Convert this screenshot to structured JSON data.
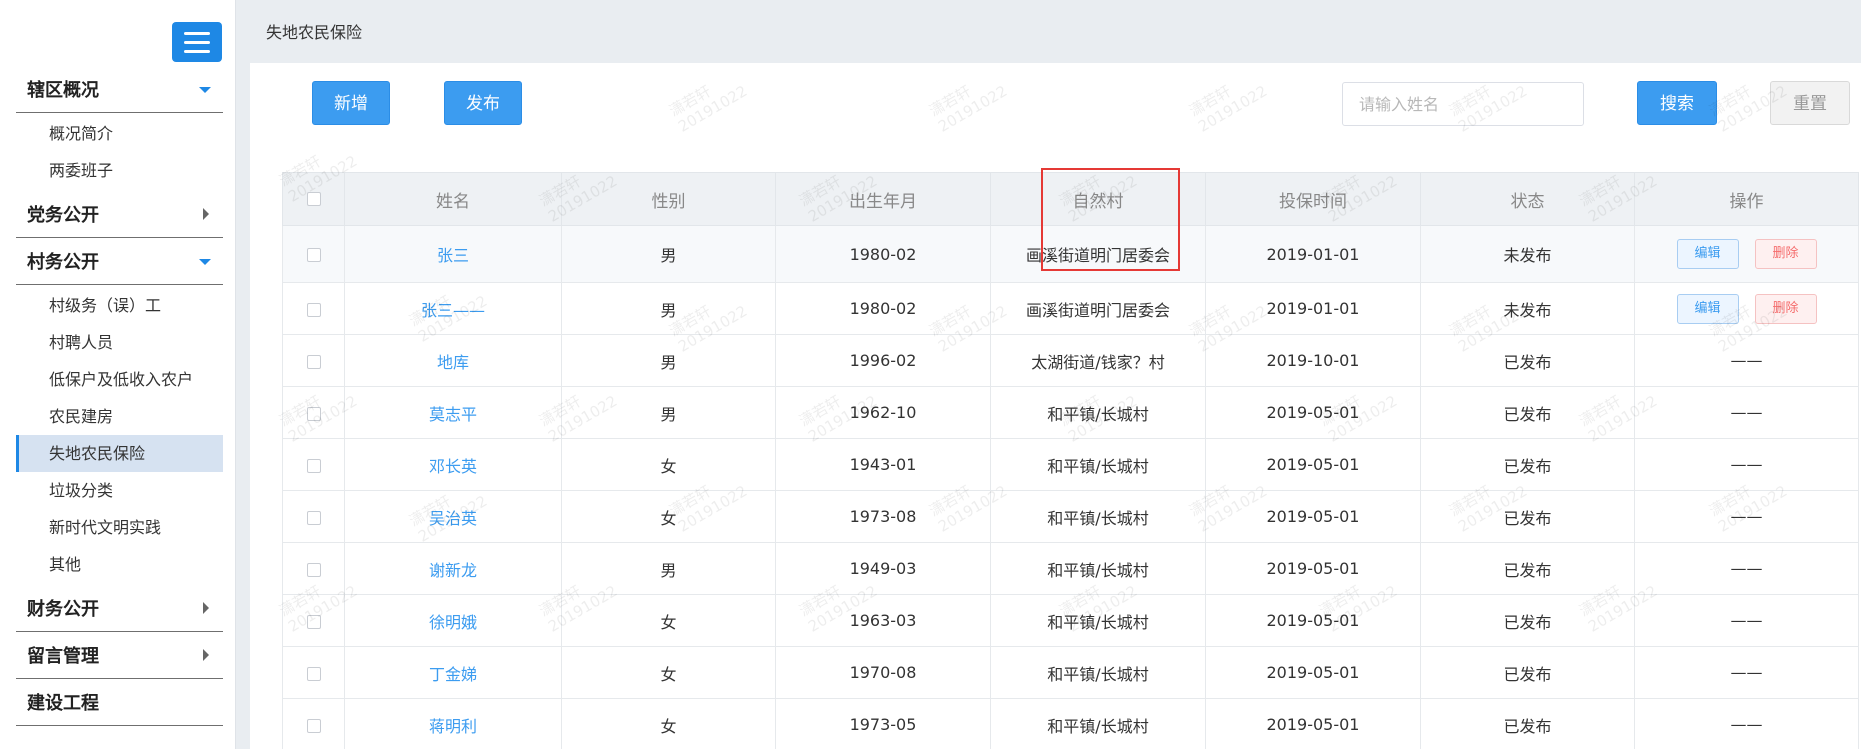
{
  "sidebar": {
    "menu_icon": "hamburger-icon",
    "groups": [
      {
        "label": "辖区概况",
        "expanded": true,
        "items": [
          "概况简介",
          "两委班子"
        ]
      },
      {
        "label": "党务公开",
        "expanded": false,
        "items": []
      },
      {
        "label": "村务公开",
        "expanded": true,
        "items": [
          "村级务（误）工",
          "村聘人员",
          "低保户及低收入农户",
          "农民建房",
          "失地农民保险",
          "垃圾分类",
          "新时代文明实践",
          "其他"
        ],
        "active": "失地农民保险"
      },
      {
        "label": "财务公开",
        "expanded": false,
        "items": []
      },
      {
        "label": "留言管理",
        "expanded": false,
        "items": []
      },
      {
        "label": "建设工程",
        "expanded": false,
        "items": []
      }
    ]
  },
  "header": {
    "breadcrumb": "失地农民保险"
  },
  "toolbar": {
    "add_label": "新增",
    "publish_label": "发布",
    "search_placeholder": "请输入姓名",
    "search_label": "搜索",
    "reset_label": "重置"
  },
  "table": {
    "columns": [
      "姓名",
      "性别",
      "出生年月",
      "自然村",
      "投保时间",
      "状态",
      "操作"
    ],
    "rows": [
      {
        "name": "张三",
        "gender": "男",
        "birth": "1980-02",
        "village": "画溪街道明门居委会",
        "insured": "2019-01-01",
        "status": "未发布",
        "actions": true
      },
      {
        "name": "张三——",
        "gender": "男",
        "birth": "1980-02",
        "village": "画溪街道明门居委会",
        "insured": "2019-01-01",
        "status": "未发布",
        "actions": true
      },
      {
        "name": "地库",
        "gender": "男",
        "birth": "1996-02",
        "village": "太湖街道/钱家？村",
        "insured": "2019-10-01",
        "status": "已发布",
        "actions": false
      },
      {
        "name": "莫志平",
        "gender": "男",
        "birth": "1962-10",
        "village": "和平镇/长城村",
        "insured": "2019-05-01",
        "status": "已发布",
        "actions": false
      },
      {
        "name": "邓长英",
        "gender": "女",
        "birth": "1943-01",
        "village": "和平镇/长城村",
        "insured": "2019-05-01",
        "status": "已发布",
        "actions": false
      },
      {
        "name": "吴治英",
        "gender": "女",
        "birth": "1973-08",
        "village": "和平镇/长城村",
        "insured": "2019-05-01",
        "status": "已发布",
        "actions": false
      },
      {
        "name": "谢新龙",
        "gender": "男",
        "birth": "1949-03",
        "village": "和平镇/长城村",
        "insured": "2019-05-01",
        "status": "已发布",
        "actions": false
      },
      {
        "name": "徐明娥",
        "gender": "女",
        "birth": "1963-03",
        "village": "和平镇/长城村",
        "insured": "2019-05-01",
        "status": "已发布",
        "actions": false
      },
      {
        "name": "丁金娣",
        "gender": "女",
        "birth": "1970-08",
        "village": "和平镇/长城村",
        "insured": "2019-05-01",
        "status": "已发布",
        "actions": false
      },
      {
        "name": "蒋明利",
        "gender": "女",
        "birth": "1973-05",
        "village": "和平镇/长城村",
        "insured": "2019-05-01",
        "status": "已发布",
        "actions": false
      }
    ],
    "edit_label": "编辑",
    "delete_label": "删除",
    "no_action": "——"
  },
  "watermark": "潇若轩\n20191022"
}
